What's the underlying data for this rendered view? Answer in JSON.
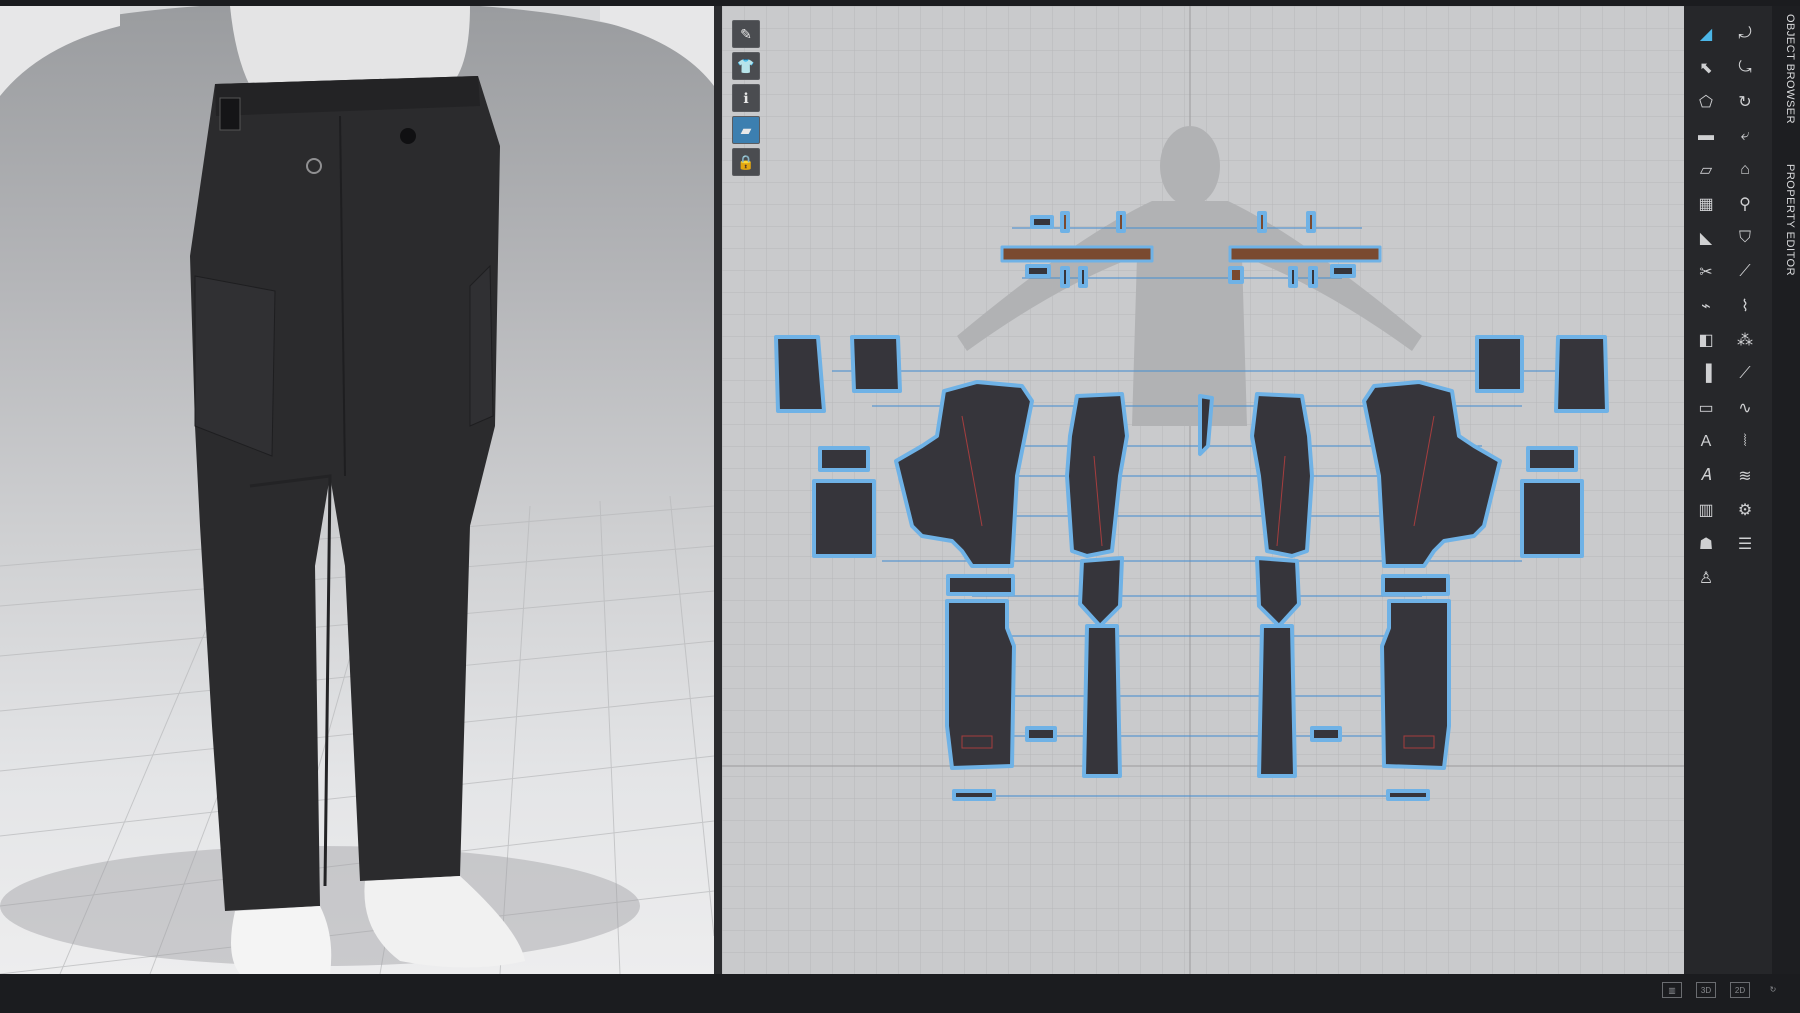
{
  "app": {
    "accent_color": "#4bb6e8",
    "background": "#1e1f22"
  },
  "view3d": {
    "name": "3D Garment Window",
    "garment_color": "#2b2b2d",
    "shoe_color": "#f2f2f2"
  },
  "view2d": {
    "name": "2D Pattern Window",
    "pattern_fill": "#36353b",
    "pattern_outline": "#6fb2e6",
    "seam_line_color": "#4a8fd0",
    "toolbar": [
      {
        "icon": "edit-pattern-icon"
      },
      {
        "icon": "shirt-icon"
      },
      {
        "icon": "info-icon"
      },
      {
        "icon": "fabric-icon"
      },
      {
        "icon": "lock-shirt-icon"
      }
    ]
  },
  "right_toolbar": {
    "tools": [
      {
        "icon": "select-arrow-icon"
      },
      {
        "icon": "transform-icon"
      },
      {
        "icon": "edit-point-icon"
      },
      {
        "icon": "transform-pattern-icon"
      },
      {
        "icon": "polygon-icon"
      },
      {
        "icon": "rotate-icon"
      },
      {
        "icon": "rectangle-icon"
      },
      {
        "icon": "sew-icon"
      },
      {
        "icon": "internal-polygon-icon"
      },
      {
        "icon": "iron-icon"
      },
      {
        "icon": "grid-pattern-icon"
      },
      {
        "icon": "pin-icon"
      },
      {
        "icon": "dart-icon"
      },
      {
        "icon": "garment-icon"
      },
      {
        "icon": "cut-icon"
      },
      {
        "icon": "fold-icon"
      },
      {
        "icon": "trace-icon"
      },
      {
        "icon": "seam-icon"
      },
      {
        "icon": "button-icon"
      },
      {
        "icon": "topstitch-icon"
      },
      {
        "icon": "elastic-icon"
      },
      {
        "icon": "measure-icon"
      },
      {
        "icon": "ruler-icon"
      },
      {
        "icon": "wave-icon"
      },
      {
        "icon": "text-tool-icon"
      },
      {
        "icon": "zipper-icon"
      },
      {
        "icon": "text-style-icon"
      },
      {
        "icon": "puckering-icon"
      },
      {
        "icon": "grain-icon"
      },
      {
        "icon": "trim-icon"
      },
      {
        "icon": "avatar-pose-icon"
      },
      {
        "icon": "stack-icon"
      },
      {
        "icon": "figure-icon"
      }
    ]
  },
  "vertical_tabs": {
    "object_browser": "OBJECT BROWSER",
    "property_editor": "PROPERTY EDITOR"
  },
  "status_bar": {
    "layout_single": "",
    "layout_3d": "3D",
    "layout_2d": "2D"
  }
}
